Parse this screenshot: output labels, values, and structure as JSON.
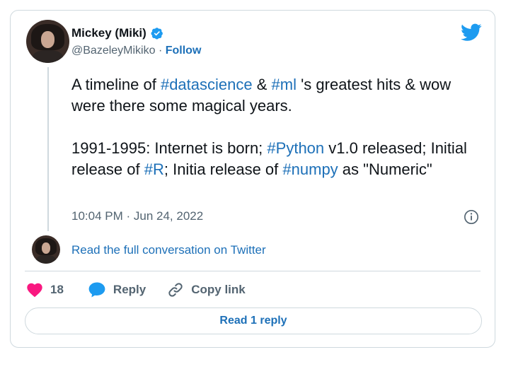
{
  "author": {
    "name": "Mickey (Miki)",
    "handle": "@BazeleyMikiko",
    "separator": "·",
    "follow_label": "Follow"
  },
  "tweet": {
    "paragraph1": {
      "t1": "A timeline of ",
      "tag1": "#datascience",
      "t2": " & ",
      "tag2": "#ml",
      "t3": " 's greatest hits & wow were there some magical years."
    },
    "paragraph2": {
      "t1": "1991-1995: Internet is born; ",
      "tag1": "#Python",
      "t2": " v1.0 released; Initial release of ",
      "tag2": "#R",
      "t3": "; Initia release of ",
      "tag3": "#numpy",
      "t4": " as \"Numeric\""
    },
    "timestamp": "10:04 PM · Jun 24, 2022"
  },
  "thread": {
    "read_conversation_label": "Read the full conversation on Twitter"
  },
  "actions": {
    "like_count": "18",
    "reply_label": "Reply",
    "copy_link_label": "Copy link"
  },
  "footer": {
    "read_replies_label": "Read 1 reply"
  },
  "colors": {
    "link": "#1d70b8",
    "twitter_blue": "#1d9bf0",
    "like_pink": "#f91880",
    "muted": "#536471",
    "border": "#cfd9de"
  },
  "icons": {
    "verified": "verified-badge-icon",
    "brand": "twitter-bird-icon",
    "info": "info-icon",
    "like": "heart-icon",
    "reply": "speech-bubble-icon",
    "copy_link": "link-icon"
  }
}
